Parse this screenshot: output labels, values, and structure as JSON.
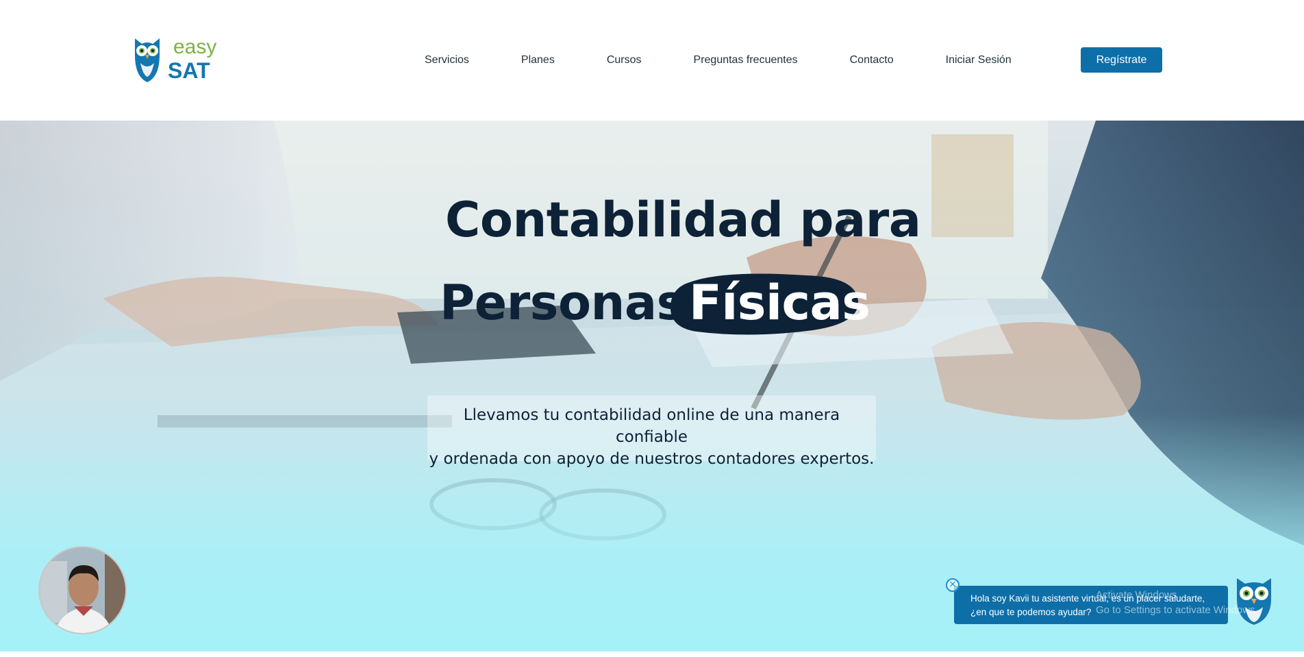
{
  "brand": {
    "logo_word_1": "easy",
    "logo_word_2": "SAT"
  },
  "nav": {
    "items": [
      {
        "label": "Servicios"
      },
      {
        "label": "Planes"
      },
      {
        "label": "Cursos"
      },
      {
        "label": "Preguntas frecuentes"
      },
      {
        "label": "Contacto"
      },
      {
        "label": "Iniciar Sesión"
      }
    ],
    "register_label": "Regístrate"
  },
  "hero": {
    "headline_line1": "Contabilidad para",
    "headline_line2_plain": "Personas",
    "headline_line2_highlight": "Físicas",
    "subtitle_line1": "Llevamos tu contabilidad online de una manera confiable",
    "subtitle_line2": "y ordenada con apoyo de nuestros contadores expertos."
  },
  "chat": {
    "close_symbol": "×",
    "message_line1": "Hola soy Kavii tu asistente virtual, es un placer saludarte,",
    "message_line2": "¿en que te podemos ayudar?",
    "icon": "owl-mascot-icon"
  },
  "video_widget": {
    "icon": "presenter-video-avatar"
  },
  "os_watermark": {
    "line1": "Activate Windows",
    "line2": "Go to Settings to activate Windows."
  },
  "colors": {
    "primary": "#0e6fa8",
    "headline": "#0d2237",
    "logo_green": "#7ab342",
    "hero_cyan": "#a6f0f8"
  }
}
